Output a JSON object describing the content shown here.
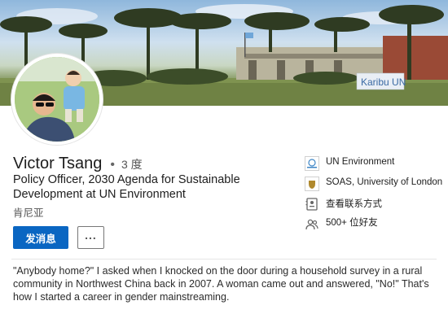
{
  "cover": {
    "sign_text": "Karibu UN"
  },
  "profile": {
    "name": "Victor Tsang",
    "separator": "•",
    "degree": "3 度",
    "headline": "Policy Officer, 2030 Agenda for Sustainable Development at UN Environment",
    "location": "肯尼亚"
  },
  "actions": {
    "message_label": "发消息",
    "more_label": "..."
  },
  "side": {
    "items": [
      {
        "label": "UN Environment",
        "icon": "un-environment-logo-icon"
      },
      {
        "label": "SOAS, University of London",
        "icon": "soas-logo-icon"
      },
      {
        "label": "查看联系方式",
        "icon": "contact-card-icon"
      },
      {
        "label": "500+ 位好友",
        "icon": "people-icon"
      }
    ]
  },
  "summary": {
    "text": "\"Anybody home?\" I asked when I knocked on the door during a household survey in a rural community in Northwest China back in 2007. A woman came out and answered, \"No!\" That's how I started a career in gender mainstreaming."
  },
  "colors": {
    "primary": "#0a66c2"
  }
}
